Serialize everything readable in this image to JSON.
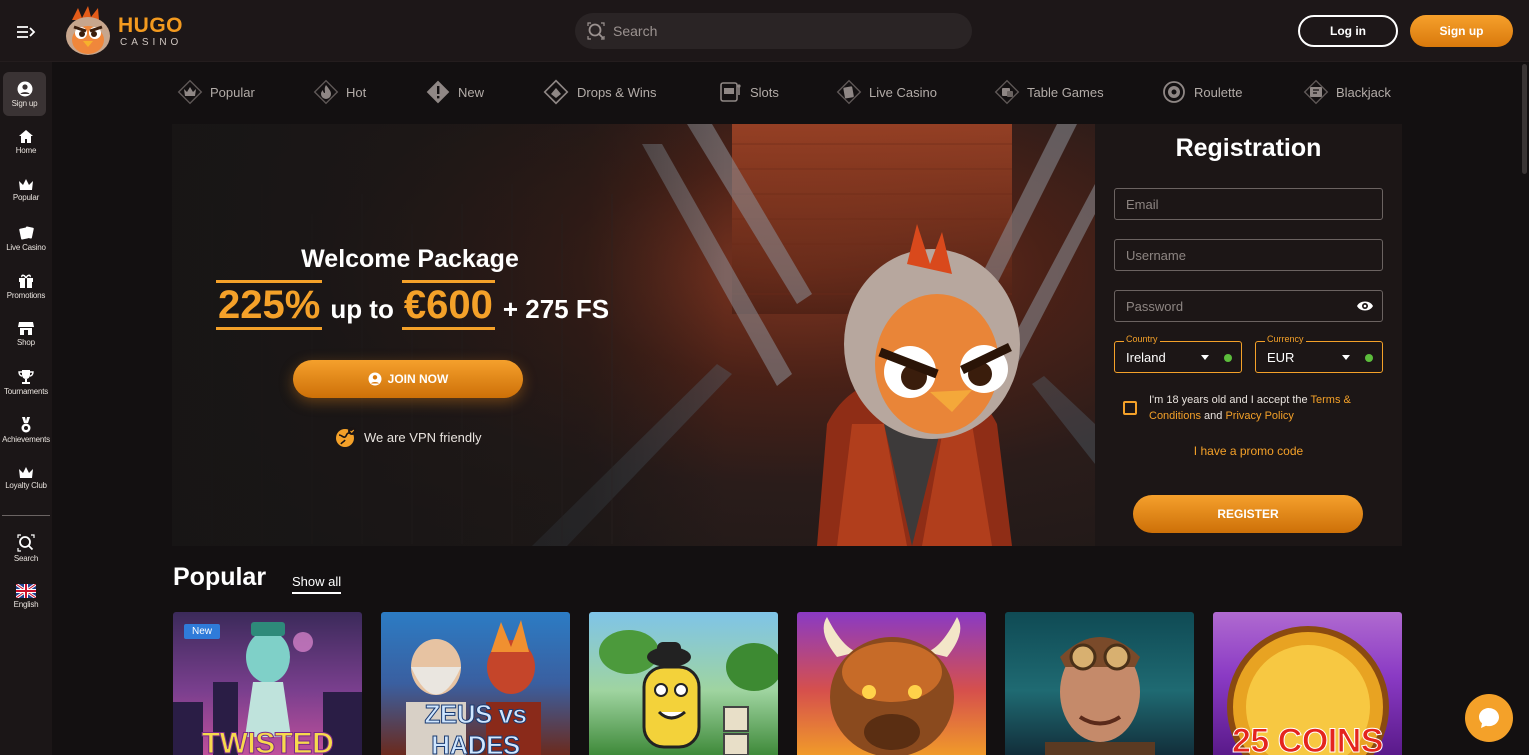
{
  "header": {
    "logo_text": "HUGO",
    "logo_sub": "CASINO",
    "search_placeholder": "Search",
    "login_label": "Log in",
    "signup_label": "Sign up"
  },
  "sidebar": {
    "items": [
      {
        "label": "Sign up",
        "icon": "user-icon"
      },
      {
        "label": "Home",
        "icon": "home-icon"
      },
      {
        "label": "Popular",
        "icon": "crown-icon"
      },
      {
        "label": "Live Casino",
        "icon": "cards-icon"
      },
      {
        "label": "Promotions",
        "icon": "gift-icon"
      },
      {
        "label": "Shop",
        "icon": "shop-icon"
      },
      {
        "label": "Tournaments",
        "icon": "trophy-icon"
      },
      {
        "label": "Achievements",
        "icon": "medal-icon"
      },
      {
        "label": "Loyalty Club",
        "icon": "crown-icon"
      },
      {
        "label": "Search",
        "icon": "search-icon"
      },
      {
        "label": "English",
        "icon": "uk-flag-icon"
      }
    ]
  },
  "categories": [
    {
      "label": "Popular",
      "icon": "crown-icon"
    },
    {
      "label": "Hot",
      "icon": "flame-icon"
    },
    {
      "label": "New",
      "icon": "exclamation-icon"
    },
    {
      "label": "Drops & Wins",
      "icon": "drop-icon"
    },
    {
      "label": "Slots",
      "icon": "slot-machine-icon"
    },
    {
      "label": "Live Casino",
      "icon": "cards-icon"
    },
    {
      "label": "Table Games",
      "icon": "dice-icon"
    },
    {
      "label": "Roulette",
      "icon": "roulette-icon"
    },
    {
      "label": "Blackjack",
      "icon": "blackjack-icon"
    }
  ],
  "hero": {
    "welcome": "Welcome Package",
    "bonus_pct": "225%",
    "bonus_mid": "up to",
    "bonus_amount": "€600",
    "bonus_fs": "+ 275 FS",
    "join_label": "JOIN NOW",
    "vpn_label": "We are VPN friendly"
  },
  "registration": {
    "title": "Registration",
    "email_placeholder": "Email",
    "username_placeholder": "Username",
    "password_placeholder": "Password",
    "country_label": "Country",
    "country_value": "Ireland",
    "currency_label": "Currency",
    "currency_value": "EUR",
    "terms_prefix": "I'm 18 years old and I accept the",
    "terms_link": "Terms & Conditions",
    "terms_and": "and",
    "privacy_link": "Privacy Policy",
    "promo_label": "I have a promo code",
    "register_label": "REGISTER"
  },
  "popular": {
    "title": "Popular",
    "show_all": "Show all",
    "games": [
      {
        "title": "TWISTED",
        "badge": "New"
      },
      {
        "title": "ZEUS vs HADES",
        "badge": ""
      },
      {
        "title": "",
        "badge": ""
      },
      {
        "title": "",
        "badge": ""
      },
      {
        "title": "",
        "badge": ""
      },
      {
        "title": "25 COINS",
        "badge": ""
      }
    ]
  },
  "colors": {
    "accent": "#f4a129",
    "background": "#131011",
    "sidebar": "#1b1617",
    "badge_new": "#2f7bd9",
    "status_ok": "#5cbd3c"
  }
}
